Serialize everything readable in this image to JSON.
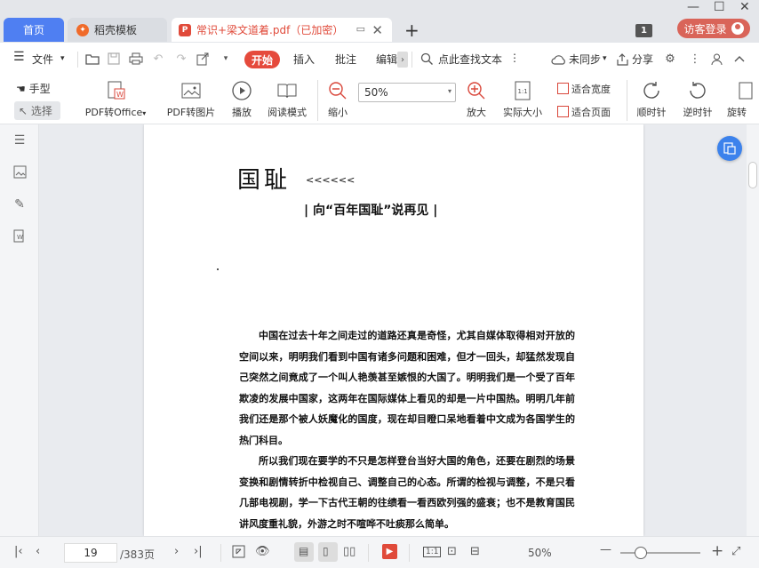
{
  "tabs": {
    "home": "首页",
    "daoke": "稻壳模板",
    "doc": "常识+梁文道着.pdf（已加密）",
    "add": "+"
  },
  "window": {
    "badge": "1",
    "login": "访客登录"
  },
  "menu": {
    "file": "文件",
    "start": "开始",
    "insert": "插入",
    "annotate": "批注",
    "edit": "编辑",
    "search": "点此查找文本",
    "sync": "未同步",
    "share": "分享"
  },
  "ribbon": {
    "hand": "手型",
    "select": "选择",
    "pdf_office": "PDF转Office",
    "pdf_image": "PDF转图片",
    "play": "播放",
    "read_mode": "阅读模式",
    "zoom_out": "缩小",
    "zoom_value": "50%",
    "zoom_in": "放大",
    "actual_size": "实际大小",
    "fit_width": "适合宽度",
    "fit_page": "适合页面",
    "rotate_cw": "顺时针",
    "rotate_ccw": "逆时针",
    "rotate": "旋转"
  },
  "document": {
    "title": "国耻",
    "arrows": "<<<<<<",
    "subtitle": "| 向“百年国耻”说再见 |",
    "para1": "中国在过去十年之间走过的道路还真是奇怪，尤其自媒体取得相对开放的空间以来，明明我们看到中国有诸多问题和困难，但才一回头，却猛然发现自己突然之间竟成了一个叫人艳羡甚至嫉恨的大国了。明明我们是一个受了百年欺凌的发展中国家，这两年在国际媒体上看见的却是一片中国热。明明几年前我们还是那个被人妖魔化的国度，现在却目瞪口呆地看着中文成为各国学生的热门科目。",
    "para2": "所以我们现在要学的不只是怎样登台当好大国的角色，还要在剧烈的场景变换和剧情转折中检视自己、调整自己的心态。所谓的检视与调整，不是只看几部电视剧，学一下古代王朝的往绩看一看西欧列强的盛衰；也不是教育国民讲风度重礼貌，外游之时不喧哗不吐痰那么简单。"
  },
  "status": {
    "page": "19",
    "total": "/383页",
    "zoom": "50%"
  }
}
